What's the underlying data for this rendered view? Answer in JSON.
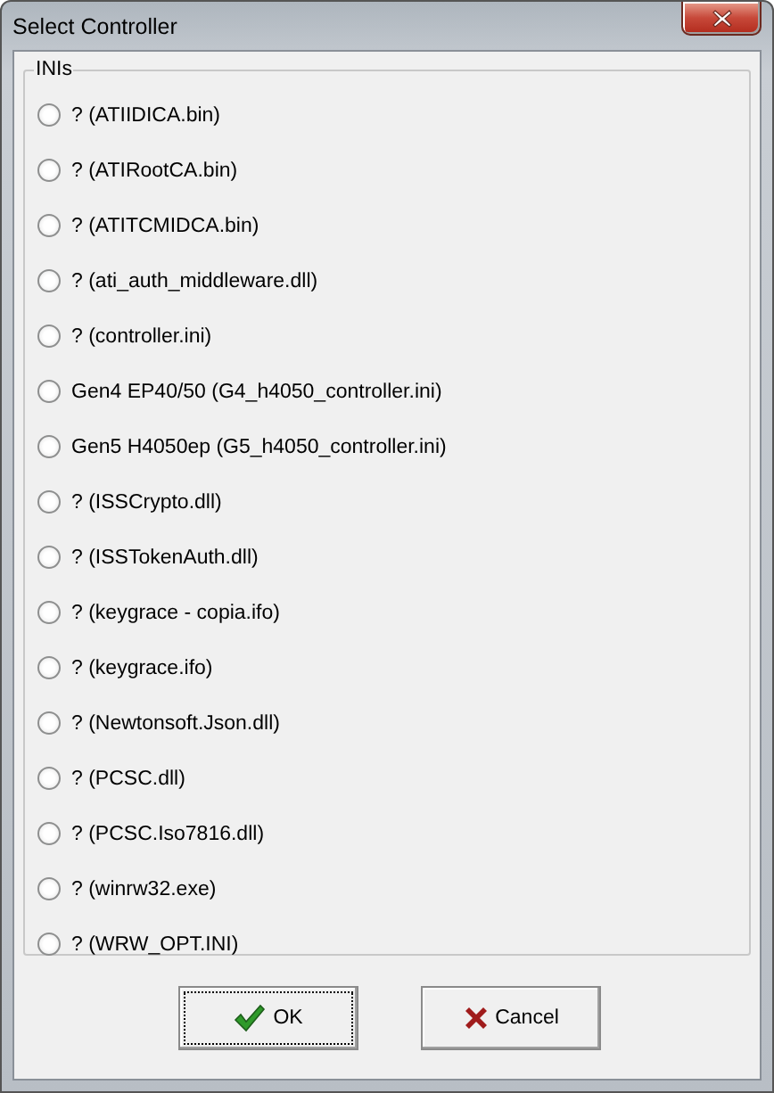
{
  "window": {
    "title": "Select Controller"
  },
  "group": {
    "title": "INIs",
    "options": [
      {
        "label": "? (ATIIDICA.bin)",
        "selected": false
      },
      {
        "label": "? (ATIRootCA.bin)",
        "selected": false
      },
      {
        "label": "? (ATITCMIDCA.bin)",
        "selected": false
      },
      {
        "label": "? (ati_auth_middleware.dll)",
        "selected": false
      },
      {
        "label": "? (controller.ini)",
        "selected": false
      },
      {
        "label": "Gen4 EP40/50 (G4_h4050_controller.ini)",
        "selected": false
      },
      {
        "label": "Gen5 H4050ep (G5_h4050_controller.ini)",
        "selected": false
      },
      {
        "label": "? (ISSCrypto.dll)",
        "selected": false
      },
      {
        "label": "? (ISSTokenAuth.dll)",
        "selected": false
      },
      {
        "label": "? (keygrace - copia.ifo)",
        "selected": false
      },
      {
        "label": "? (keygrace.ifo)",
        "selected": false
      },
      {
        "label": "? (Newtonsoft.Json.dll)",
        "selected": false
      },
      {
        "label": "? (PCSC.dll)",
        "selected": false
      },
      {
        "label": "? (PCSC.Iso7816.dll)",
        "selected": false
      },
      {
        "label": "? (winrw32.exe)",
        "selected": false
      },
      {
        "label": "? (WRW_OPT.INI)",
        "selected": false
      }
    ]
  },
  "buttons": [
    {
      "label": "OK",
      "kind": "ok"
    },
    {
      "label": "Cancel",
      "kind": "cancel"
    }
  ]
}
